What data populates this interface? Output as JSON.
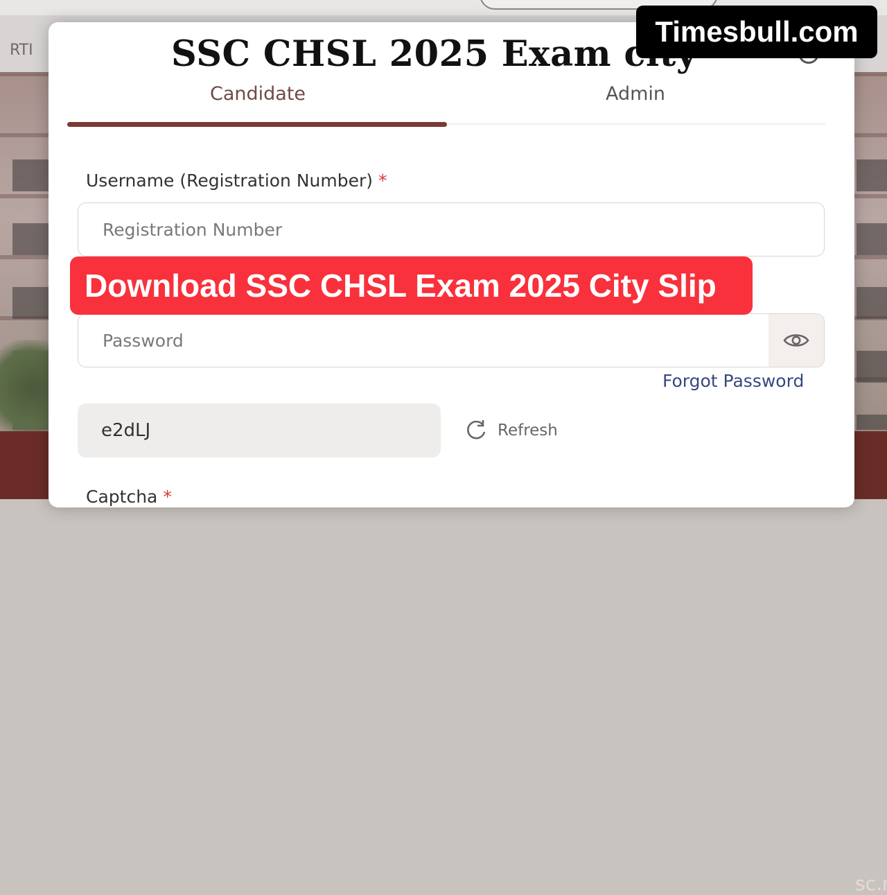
{
  "background": {
    "nav_item": "RTI",
    "footer_text": "sc.r"
  },
  "modal": {
    "headline": "SSC CHSL 2025 Exam city",
    "tabs": [
      {
        "label": "Candidate",
        "active": true
      },
      {
        "label": "Admin",
        "active": false
      }
    ],
    "username": {
      "label": "Username (Registration Number)",
      "required_mark": "*",
      "placeholder": "Registration Number",
      "value": ""
    },
    "password": {
      "placeholder": "Password",
      "value": "",
      "toggle_icon": "eye-icon"
    },
    "forgot_password": "Forgot Password",
    "captcha": {
      "code": "e2dLJ",
      "refresh_label": "Refresh",
      "label": "Captcha",
      "required_mark": "*"
    }
  },
  "overlays": {
    "brand": "Timesbull.com",
    "banner": "Download SSC CHSL Exam 2025 City Slip"
  },
  "colors": {
    "active_tab_underline": "#7a3a34",
    "banner_bg": "#f8313c",
    "brand_bg": "#000000",
    "link": "#37487f",
    "required": "#d43a35"
  }
}
